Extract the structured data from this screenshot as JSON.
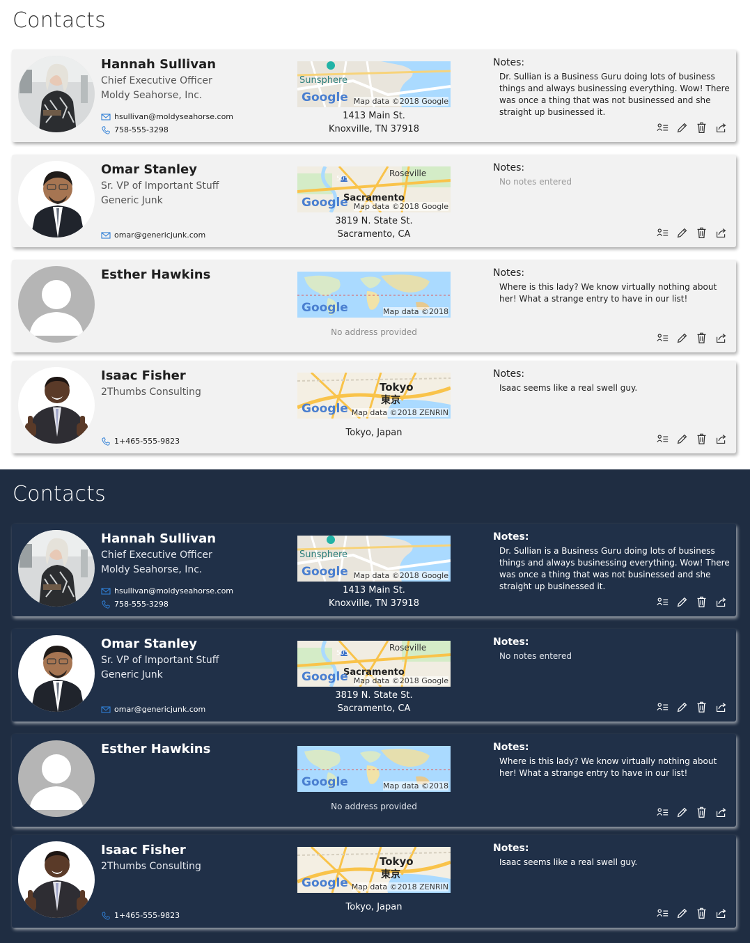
{
  "page_title": "Contacts",
  "colors": {
    "light_bg": "#ffffff",
    "light_card": "#f2f2f2",
    "dark_bg": "#1f2d42",
    "dark_card": "#203048",
    "link_blue": "#2f7fd6"
  },
  "contacts": [
    {
      "name": "Hannah Sullivan",
      "line1": "Chief Executive Officer",
      "line2": "Moldy Seahorse, Inc.",
      "email": "hsullivan@moldyseahorse.com",
      "phone": "758-555-3298",
      "address1": "1413 Main St.",
      "address2": "Knoxville, TN 37918",
      "map": {
        "label_place": "Sunsphere",
        "attribution": "Map data ©2018 Google",
        "logo": "Google"
      },
      "notes_label": "Notes:",
      "notes": "Dr. Sullian is a Business Guru doing lots of business things and always businessing everything. Wow! There was once a thing that was not businessed and she straight up businessed it."
    },
    {
      "name": "Omar Stanley",
      "line1": "Sr. VP of Important Stuff",
      "line2": "Generic Junk",
      "email": "omar@genericjunk.com",
      "phone": "",
      "address1": "3819 N. State St.",
      "address2": "Sacramento, CA",
      "map": {
        "label_place": "Sacramento",
        "label_place2": "Roseville",
        "shield": "505",
        "attribution": "Map data ©2018 Google",
        "logo": "Google"
      },
      "notes_label": "Notes:",
      "notes": "No notes entered"
    },
    {
      "name": "Esther Hawkins",
      "line1": "",
      "line2": "",
      "email": "",
      "phone": "",
      "no_address": "No address provided",
      "map": {
        "attribution": "Map data ©2018",
        "logo": "Google"
      },
      "notes_label": "Notes:",
      "notes": "Where is this lady? We know virtually nothing about her! What a strange entry to have in our list!"
    },
    {
      "name": "Isaac Fisher",
      "line1": "2Thumbs Consulting",
      "line2": "",
      "email": "",
      "phone": "1+465-555-9823",
      "address1": "Tokyo, Japan",
      "map": {
        "label_place": "Tokyo",
        "label_place_local": "東京",
        "attribution": "Map data ©2018 ZENRIN",
        "logo": "Google"
      },
      "notes_label": "Notes:",
      "notes": "Isaac seems like a real swell guy."
    }
  ],
  "icons": {
    "email": "envelope-icon",
    "phone": "phone-icon",
    "details": "contact-card-icon",
    "edit": "pencil-icon",
    "delete": "trash-icon",
    "share": "share-icon"
  }
}
